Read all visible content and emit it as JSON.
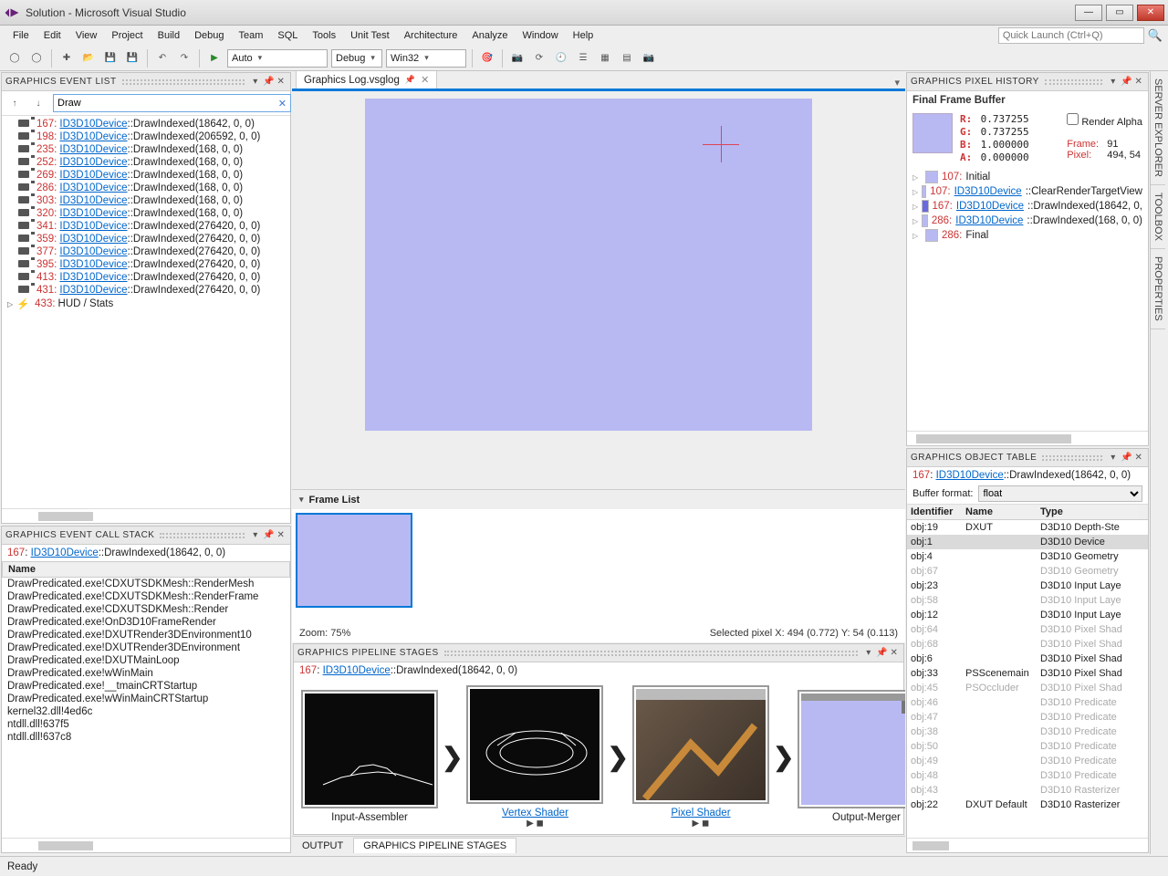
{
  "window": {
    "title": "Solution - Microsoft Visual Studio"
  },
  "menu": [
    "File",
    "Edit",
    "View",
    "Project",
    "Build",
    "Debug",
    "Team",
    "SQL",
    "Tools",
    "Unit Test",
    "Architecture",
    "Analyze",
    "Window",
    "Help"
  ],
  "quicklaunch": {
    "placeholder": "Quick Launch (Ctrl+Q)"
  },
  "toolbar": {
    "solutionConfig": "Auto",
    "platformConfig": "Debug",
    "targetConfig": "Win32"
  },
  "docTab": {
    "title": "Graphics Log.vsglog"
  },
  "frameList": {
    "header": "Frame List",
    "zoom": "Zoom: 75%",
    "selected": "Selected pixel X: 494 (0.772) Y: 54 (0.113)"
  },
  "eventList": {
    "title": "GRAPHICS EVENT LIST",
    "filter": "Draw",
    "rows": [
      {
        "idx": "167",
        "link": "ID3D10Device",
        "suffix": "::DrawIndexed(18642, 0, 0)",
        "cam": true
      },
      {
        "idx": "198",
        "link": "ID3D10Device",
        "suffix": "::DrawIndexed(206592, 0, 0)",
        "cam": true
      },
      {
        "idx": "235",
        "link": "ID3D10Device",
        "suffix": "::DrawIndexed(168, 0, 0)",
        "cam": true
      },
      {
        "idx": "252",
        "link": "ID3D10Device",
        "suffix": "::DrawIndexed(168, 0, 0)",
        "cam": true
      },
      {
        "idx": "269",
        "link": "ID3D10Device",
        "suffix": "::DrawIndexed(168, 0, 0)",
        "cam": true
      },
      {
        "idx": "286",
        "link": "ID3D10Device",
        "suffix": "::DrawIndexed(168, 0, 0)",
        "cam": true
      },
      {
        "idx": "303",
        "link": "ID3D10Device",
        "suffix": "::DrawIndexed(168, 0, 0)",
        "cam": true
      },
      {
        "idx": "320",
        "link": "ID3D10Device",
        "suffix": "::DrawIndexed(168, 0, 0)",
        "cam": true
      },
      {
        "idx": "341",
        "link": "ID3D10Device",
        "suffix": "::DrawIndexed(276420, 0, 0)",
        "cam": true
      },
      {
        "idx": "359",
        "link": "ID3D10Device",
        "suffix": "::DrawIndexed(276420, 0, 0)",
        "cam": true
      },
      {
        "idx": "377",
        "link": "ID3D10Device",
        "suffix": "::DrawIndexed(276420, 0, 0)",
        "cam": true
      },
      {
        "idx": "395",
        "link": "ID3D10Device",
        "suffix": "::DrawIndexed(276420, 0, 0)",
        "cam": true
      },
      {
        "idx": "413",
        "link": "ID3D10Device",
        "suffix": "::DrawIndexed(276420, 0, 0)",
        "cam": true
      },
      {
        "idx": "431",
        "link": "ID3D10Device",
        "suffix": "::DrawIndexed(276420, 0, 0)",
        "cam": true
      },
      {
        "idx": "433",
        "link": "",
        "suffix": "HUD / Stats",
        "cam": false,
        "expander": true
      }
    ]
  },
  "callStack": {
    "title": "GRAPHICS EVENT CALL STACK",
    "refIdx": "167",
    "refLink": "ID3D10Device",
    "refSuffix": "::DrawIndexed(18642, 0, 0)",
    "nameHeader": "Name",
    "rows": [
      "DrawPredicated.exe!CDXUTSDKMesh::RenderMesh",
      "DrawPredicated.exe!CDXUTSDKMesh::RenderFrame",
      "DrawPredicated.exe!CDXUTSDKMesh::Render",
      "DrawPredicated.exe!OnD3D10FrameRender",
      "DrawPredicated.exe!DXUTRender3DEnvironment10",
      "DrawPredicated.exe!DXUTRender3DEnvironment",
      "DrawPredicated.exe!DXUTMainLoop",
      "DrawPredicated.exe!wWinMain",
      "DrawPredicated.exe!__tmainCRTStartup",
      "DrawPredicated.exe!wWinMainCRTStartup",
      "kernel32.dll!4ed6c",
      "ntdll.dll!637f5",
      "ntdll.dll!637c8"
    ]
  },
  "pipeline": {
    "title": "GRAPHICS PIPELINE STAGES",
    "refIdx": "167",
    "refLink": "ID3D10Device",
    "refSuffix": "::DrawIndexed(18642, 0, 0)",
    "stages": {
      "ia": "Input-Assembler",
      "vs": "Vertex Shader",
      "ps": "Pixel Shader",
      "om": "Output-Merger"
    }
  },
  "pixelHistory": {
    "title": "GRAPHICS PIXEL HISTORY",
    "finalLabel": "Final Frame Buffer",
    "rgba": {
      "R": "0.737255",
      "G": "0.737255",
      "B": "1.000000",
      "A": "0.000000"
    },
    "renderAlpha": "Render Alpha",
    "frameLabel": "Frame:",
    "frameVal": "91",
    "pixelLabel": "Pixel:",
    "pixelVal": "494, 54",
    "rows": [
      {
        "idx": "107",
        "text": "Initial",
        "color": "#b8b9f2",
        "link": ""
      },
      {
        "idx": "107",
        "text": "::ClearRenderTargetView",
        "color": "#b8b9f2",
        "link": "ID3D10Device"
      },
      {
        "idx": "167",
        "text": "::DrawIndexed(18642, 0,",
        "color": "#6a6ae0",
        "link": "ID3D10Device"
      },
      {
        "idx": "286",
        "text": "::DrawIndexed(168, 0, 0)",
        "color": "#b8b9f2",
        "link": "ID3D10Device"
      },
      {
        "idx": "286",
        "text": "Final",
        "color": "#b8b9f2",
        "link": ""
      }
    ]
  },
  "objectTable": {
    "title": "GRAPHICS OBJECT TABLE",
    "refIdx": "167",
    "refLink": "ID3D10Device",
    "refSuffix": "::DrawIndexed(18642, 0, 0)",
    "bufferFormatLabel": "Buffer format:",
    "bufferFormat": "float",
    "headers": [
      "Identifier",
      "Name",
      "Type"
    ],
    "rows": [
      {
        "id": "obj:19",
        "name": "DXUT",
        "type": "D3D10 Depth-Ste",
        "dim": false
      },
      {
        "id": "obj:1",
        "name": "",
        "type": "D3D10 Device",
        "dim": false,
        "sel": true
      },
      {
        "id": "obj:4",
        "name": "",
        "type": "D3D10 Geometry",
        "dim": false
      },
      {
        "id": "obj:67",
        "name": "",
        "type": "D3D10 Geometry",
        "dim": true
      },
      {
        "id": "obj:23",
        "name": "",
        "type": "D3D10 Input Laye",
        "dim": false
      },
      {
        "id": "obj:58",
        "name": "",
        "type": "D3D10 Input Laye",
        "dim": true
      },
      {
        "id": "obj:12",
        "name": "",
        "type": "D3D10 Input Laye",
        "dim": false
      },
      {
        "id": "obj:64",
        "name": "",
        "type": "D3D10 Pixel Shad",
        "dim": true
      },
      {
        "id": "obj:68",
        "name": "",
        "type": "D3D10 Pixel Shad",
        "dim": true
      },
      {
        "id": "obj:6",
        "name": "",
        "type": "D3D10 Pixel Shad",
        "dim": false
      },
      {
        "id": "obj:33",
        "name": "PSScenemain",
        "type": "D3D10 Pixel Shad",
        "dim": false
      },
      {
        "id": "obj:45",
        "name": "PSOccluder",
        "type": "D3D10 Pixel Shad",
        "dim": true
      },
      {
        "id": "obj:46",
        "name": "",
        "type": "D3D10 Predicate",
        "dim": true
      },
      {
        "id": "obj:47",
        "name": "",
        "type": "D3D10 Predicate",
        "dim": true
      },
      {
        "id": "obj:38",
        "name": "",
        "type": "D3D10 Predicate",
        "dim": true
      },
      {
        "id": "obj:50",
        "name": "",
        "type": "D3D10 Predicate",
        "dim": true
      },
      {
        "id": "obj:49",
        "name": "",
        "type": "D3D10 Predicate",
        "dim": true
      },
      {
        "id": "obj:48",
        "name": "",
        "type": "D3D10 Predicate",
        "dim": true
      },
      {
        "id": "obj:43",
        "name": "",
        "type": "D3D10 Rasterizer",
        "dim": true
      },
      {
        "id": "obj:22",
        "name": "DXUT Default",
        "type": "D3D10 Rasterizer",
        "dim": false
      }
    ]
  },
  "bottomTabs": {
    "output": "OUTPUT",
    "pipeline": "GRAPHICS PIPELINE STAGES"
  },
  "sideTabs": [
    "SERVER EXPLORER",
    "TOOLBOX",
    "PROPERTIES"
  ],
  "status": "Ready"
}
